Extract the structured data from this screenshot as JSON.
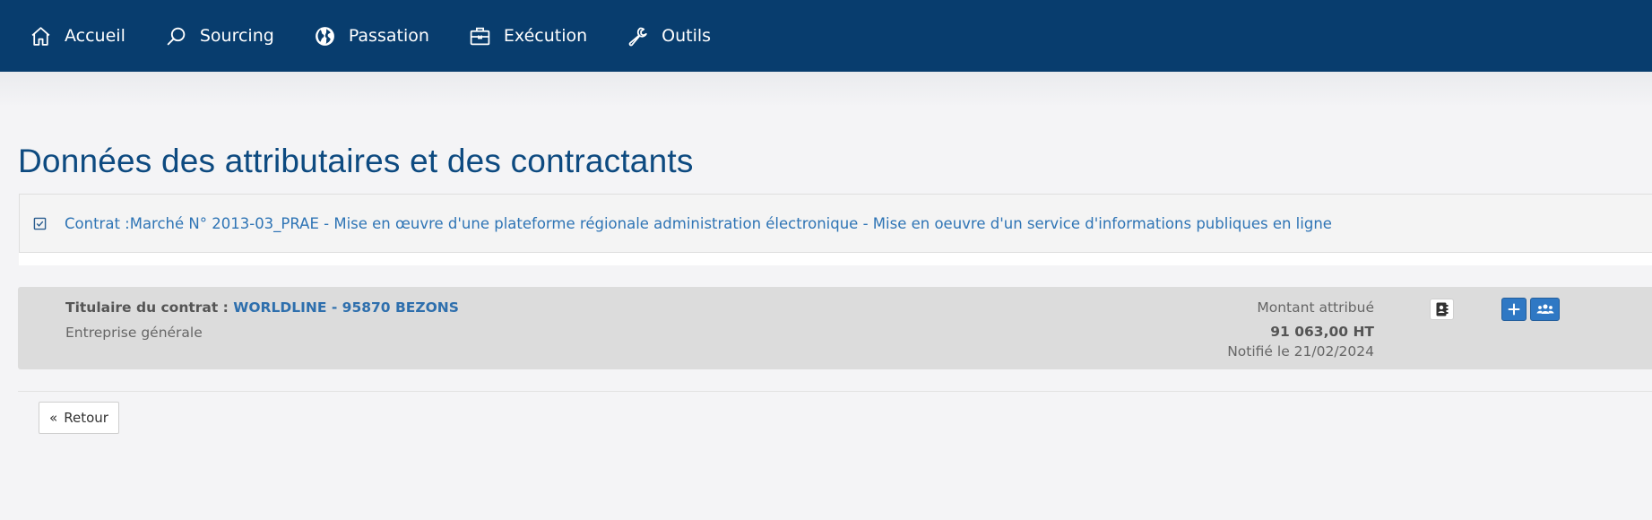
{
  "nav": {
    "items": [
      {
        "label": "Accueil",
        "icon": "home-icon"
      },
      {
        "label": "Sourcing",
        "icon": "search-icon"
      },
      {
        "label": "Passation",
        "icon": "globe-icon"
      },
      {
        "label": "Exécution",
        "icon": "briefcase-icon"
      },
      {
        "label": "Outils",
        "icon": "wrench-icon"
      }
    ]
  },
  "page": {
    "title": "Données des attributaires et des contractants"
  },
  "contract": {
    "text": "Contrat :Marché N° 2013-03_PRAE - Mise en œuvre d'une plateforme régionale administration électronique - Mise en oeuvre d'un service d'informations publiques en ligne"
  },
  "holder": {
    "label": "Titulaire du contrat : ",
    "name": "WORLDLINE - 95870 BEZONS",
    "category": "Entreprise générale",
    "amount_label": "Montant attribué",
    "amount_value": "91 063,00 HT",
    "notified": "Notifié le 21/02/2024"
  },
  "actions": {
    "back_label": "Retour"
  },
  "colors": {
    "nav_bg": "#083d6e",
    "title": "#0d4a80",
    "link": "#2e74b5",
    "button_blue": "#2f78c4"
  }
}
